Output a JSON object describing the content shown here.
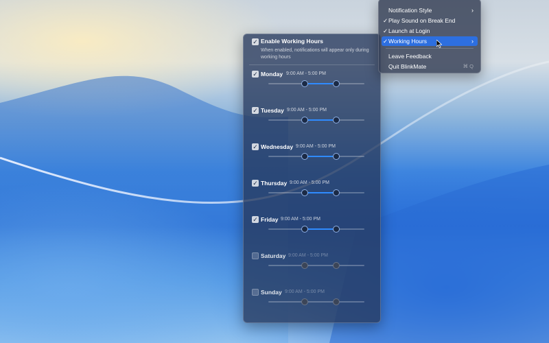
{
  "panel": {
    "enable_label": "Enable Working Hours",
    "enable_checked": true,
    "enable_desc": "When enabled, notifications will appear only during working hours",
    "days": [
      {
        "name": "Monday",
        "time": "9:00 AM - 5:00 PM",
        "enabled": true,
        "start_frac": 0.375,
        "end_frac": 0.7083
      },
      {
        "name": "Tuesday",
        "time": "9:00 AM - 5:00 PM",
        "enabled": true,
        "start_frac": 0.375,
        "end_frac": 0.7083
      },
      {
        "name": "Wednesday",
        "time": "9:00 AM - 5:00 PM",
        "enabled": true,
        "start_frac": 0.375,
        "end_frac": 0.7083
      },
      {
        "name": "Thursday",
        "time": "9:00 AM - 5:00 PM",
        "enabled": true,
        "start_frac": 0.375,
        "end_frac": 0.7083
      },
      {
        "name": "Friday",
        "time": "9:00 AM - 5:00 PM",
        "enabled": true,
        "start_frac": 0.375,
        "end_frac": 0.7083
      },
      {
        "name": "Saturday",
        "time": "9:00 AM - 5:00 PM",
        "enabled": false,
        "start_frac": 0.375,
        "end_frac": 0.7083
      },
      {
        "name": "Sunday",
        "time": "9:00 AM - 5:00 PM",
        "enabled": false,
        "start_frac": 0.375,
        "end_frac": 0.7083
      }
    ]
  },
  "menu": {
    "items": [
      {
        "label": "Notification Style",
        "checked": false,
        "submenu": true,
        "shortcut": ""
      },
      {
        "label": "Play Sound on Break End",
        "checked": true,
        "submenu": false,
        "shortcut": ""
      },
      {
        "label": "Launch at Login",
        "checked": true,
        "submenu": false,
        "shortcut": ""
      },
      {
        "label": "Working Hours",
        "checked": true,
        "submenu": true,
        "shortcut": "",
        "highlighted": true
      },
      {
        "label": "Leave Feedback",
        "checked": false,
        "submenu": false,
        "shortcut": ""
      },
      {
        "label": "Quit BlinkMate",
        "checked": false,
        "submenu": false,
        "shortcut": "⌘ Q"
      }
    ],
    "check_glyph": "✓",
    "chevron_glyph": "›"
  },
  "colors": {
    "accent": "#2f8bff",
    "menu_highlight": "#2d6fe0"
  }
}
